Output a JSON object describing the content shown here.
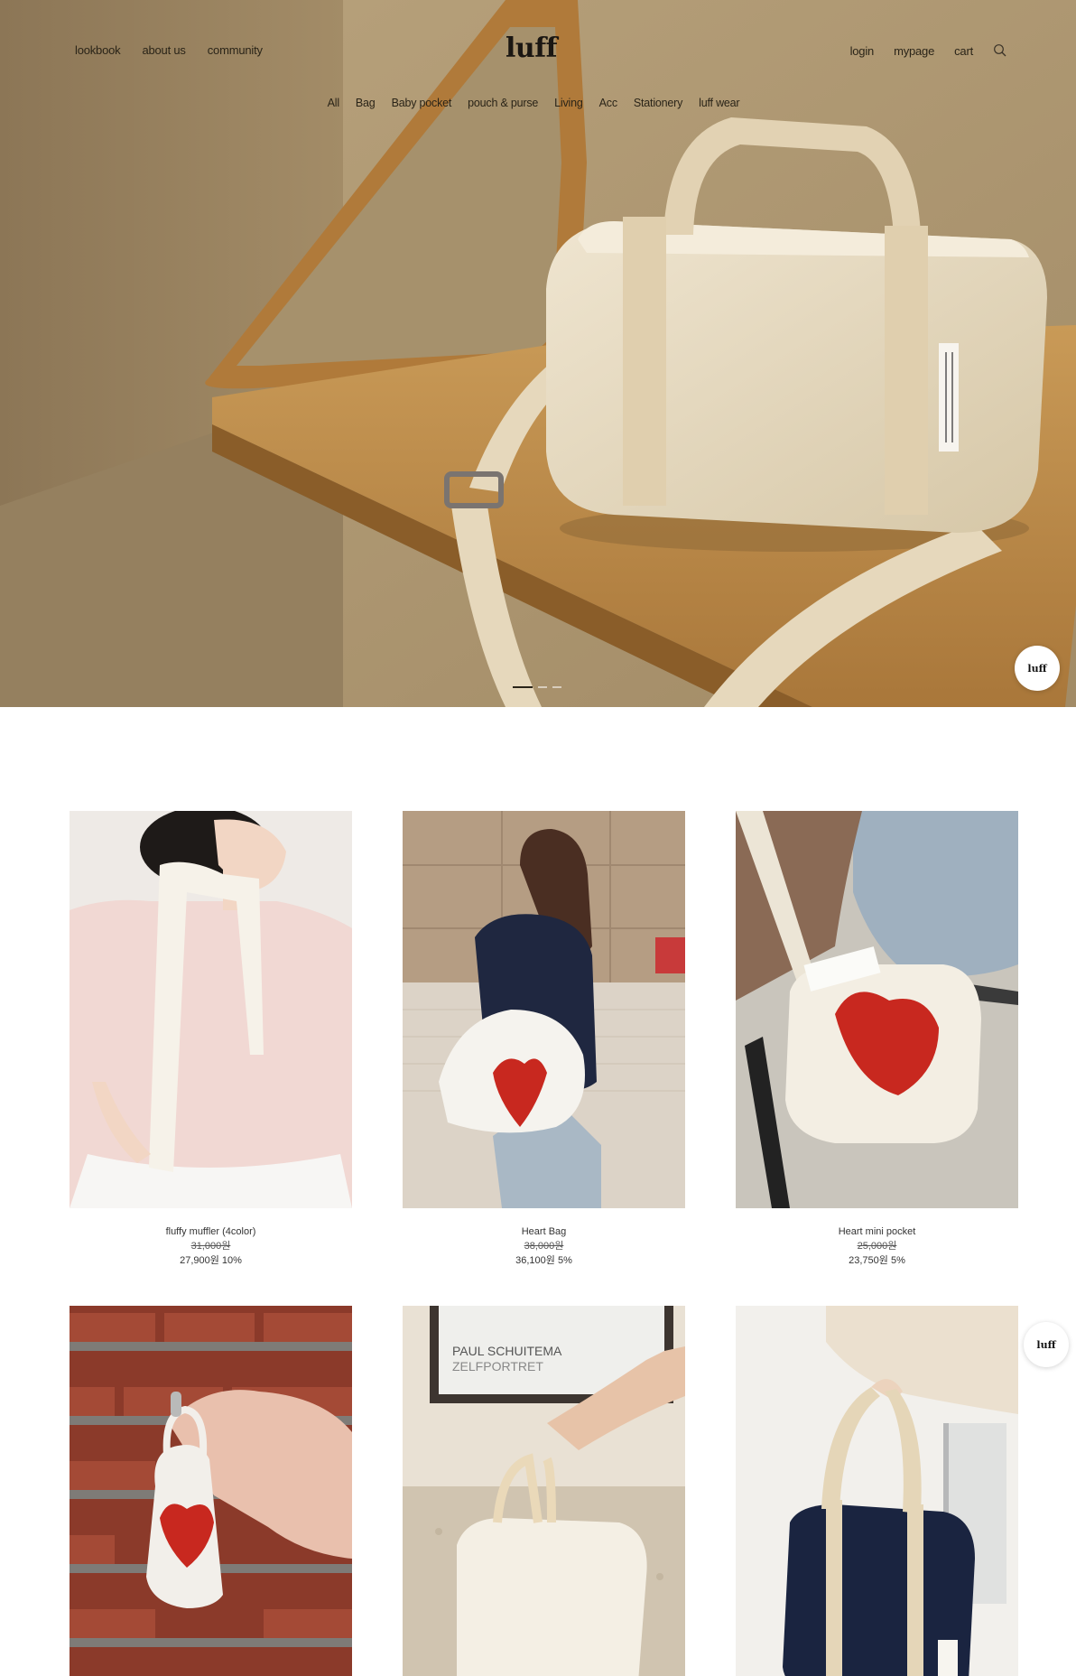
{
  "header": {
    "logo": "luff",
    "left_nav": [
      "lookbook",
      "about us",
      "community"
    ],
    "right_nav": [
      "login",
      "mypage",
      "cart"
    ],
    "search_icon": "search-icon"
  },
  "categories": [
    "All",
    "Bag",
    "Baby pocket",
    "pouch & purse",
    "Living",
    "Acc",
    "Stationery",
    "luff wear"
  ],
  "hero": {
    "slide_count": 3,
    "active_slide": 1
  },
  "floating_badge": {
    "label": "luff"
  },
  "products": [
    {
      "name": "fluffy muffler (4color)",
      "original_price": "31,000원",
      "sale_price": "27,900원 10%"
    },
    {
      "name": "Heart Bag",
      "original_price": "38,000원",
      "sale_price": "36,100원 5%"
    },
    {
      "name": "Heart mini pocket",
      "original_price": "25,000원",
      "sale_price": "23,750원 5%"
    },
    {
      "name": "",
      "original_price": "",
      "sale_price": ""
    },
    {
      "name": "",
      "original_price": "",
      "sale_price": ""
    },
    {
      "name": "",
      "original_price": "",
      "sale_price": ""
    }
  ],
  "colors": {
    "hero_bg": "#a8916b",
    "text_dark": "#2a2418",
    "heart_red": "#c8281f"
  }
}
